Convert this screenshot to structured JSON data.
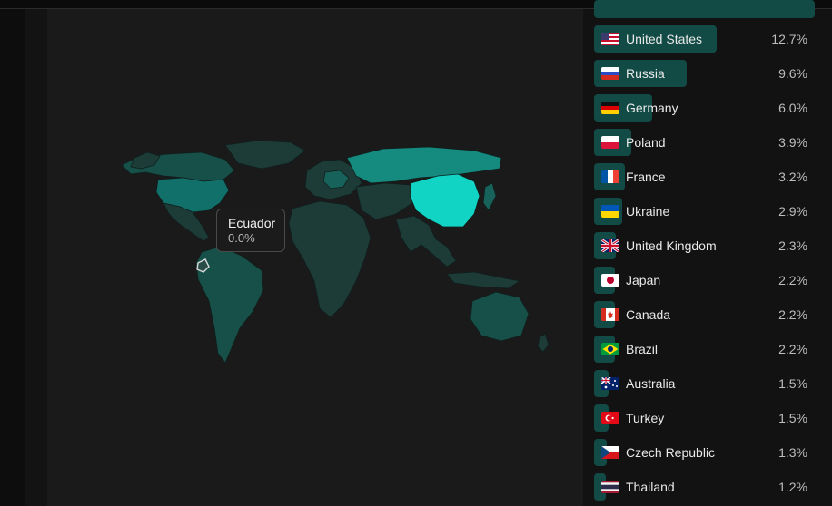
{
  "map": {
    "tooltip": {
      "country": "Ecuador",
      "value": "0.0%"
    },
    "colors": {
      "background": "#1a1a1a",
      "low": "#1d3b37",
      "mid": "#174f49",
      "high": "#0fbfb0",
      "top": "#12d4c4",
      "border": "#0f1f1d"
    }
  },
  "countries": [
    {
      "name": "United States",
      "pct": "12.7%",
      "share": 12.7,
      "flag": "us-flag-icon"
    },
    {
      "name": "Russia",
      "pct": "9.6%",
      "share": 9.6,
      "flag": "ru-flag-icon"
    },
    {
      "name": "Germany",
      "pct": "6.0%",
      "share": 6.0,
      "flag": "de-flag-icon"
    },
    {
      "name": "Poland",
      "pct": "3.9%",
      "share": 3.9,
      "flag": "pl-flag-icon"
    },
    {
      "name": "France",
      "pct": "3.2%",
      "share": 3.2,
      "flag": "fr-flag-icon"
    },
    {
      "name": "Ukraine",
      "pct": "2.9%",
      "share": 2.9,
      "flag": "ua-flag-icon"
    },
    {
      "name": "United Kingdom",
      "pct": "2.3%",
      "share": 2.3,
      "flag": "gb-flag-icon"
    },
    {
      "name": "Japan",
      "pct": "2.2%",
      "share": 2.2,
      "flag": "jp-flag-icon"
    },
    {
      "name": "Canada",
      "pct": "2.2%",
      "share": 2.2,
      "flag": "ca-flag-icon"
    },
    {
      "name": "Brazil",
      "pct": "2.2%",
      "share": 2.2,
      "flag": "br-flag-icon"
    },
    {
      "name": "Australia",
      "pct": "1.5%",
      "share": 1.5,
      "flag": "au-flag-icon"
    },
    {
      "name": "Turkey",
      "pct": "1.5%",
      "share": 1.5,
      "flag": "tr-flag-icon"
    },
    {
      "name": "Czech Republic",
      "pct": "1.3%",
      "share": 1.3,
      "flag": "cz-flag-icon"
    },
    {
      "name": "Thailand",
      "pct": "1.2%",
      "share": 1.2,
      "flag": "th-flag-icon"
    }
  ],
  "bar_color": "#124b45"
}
